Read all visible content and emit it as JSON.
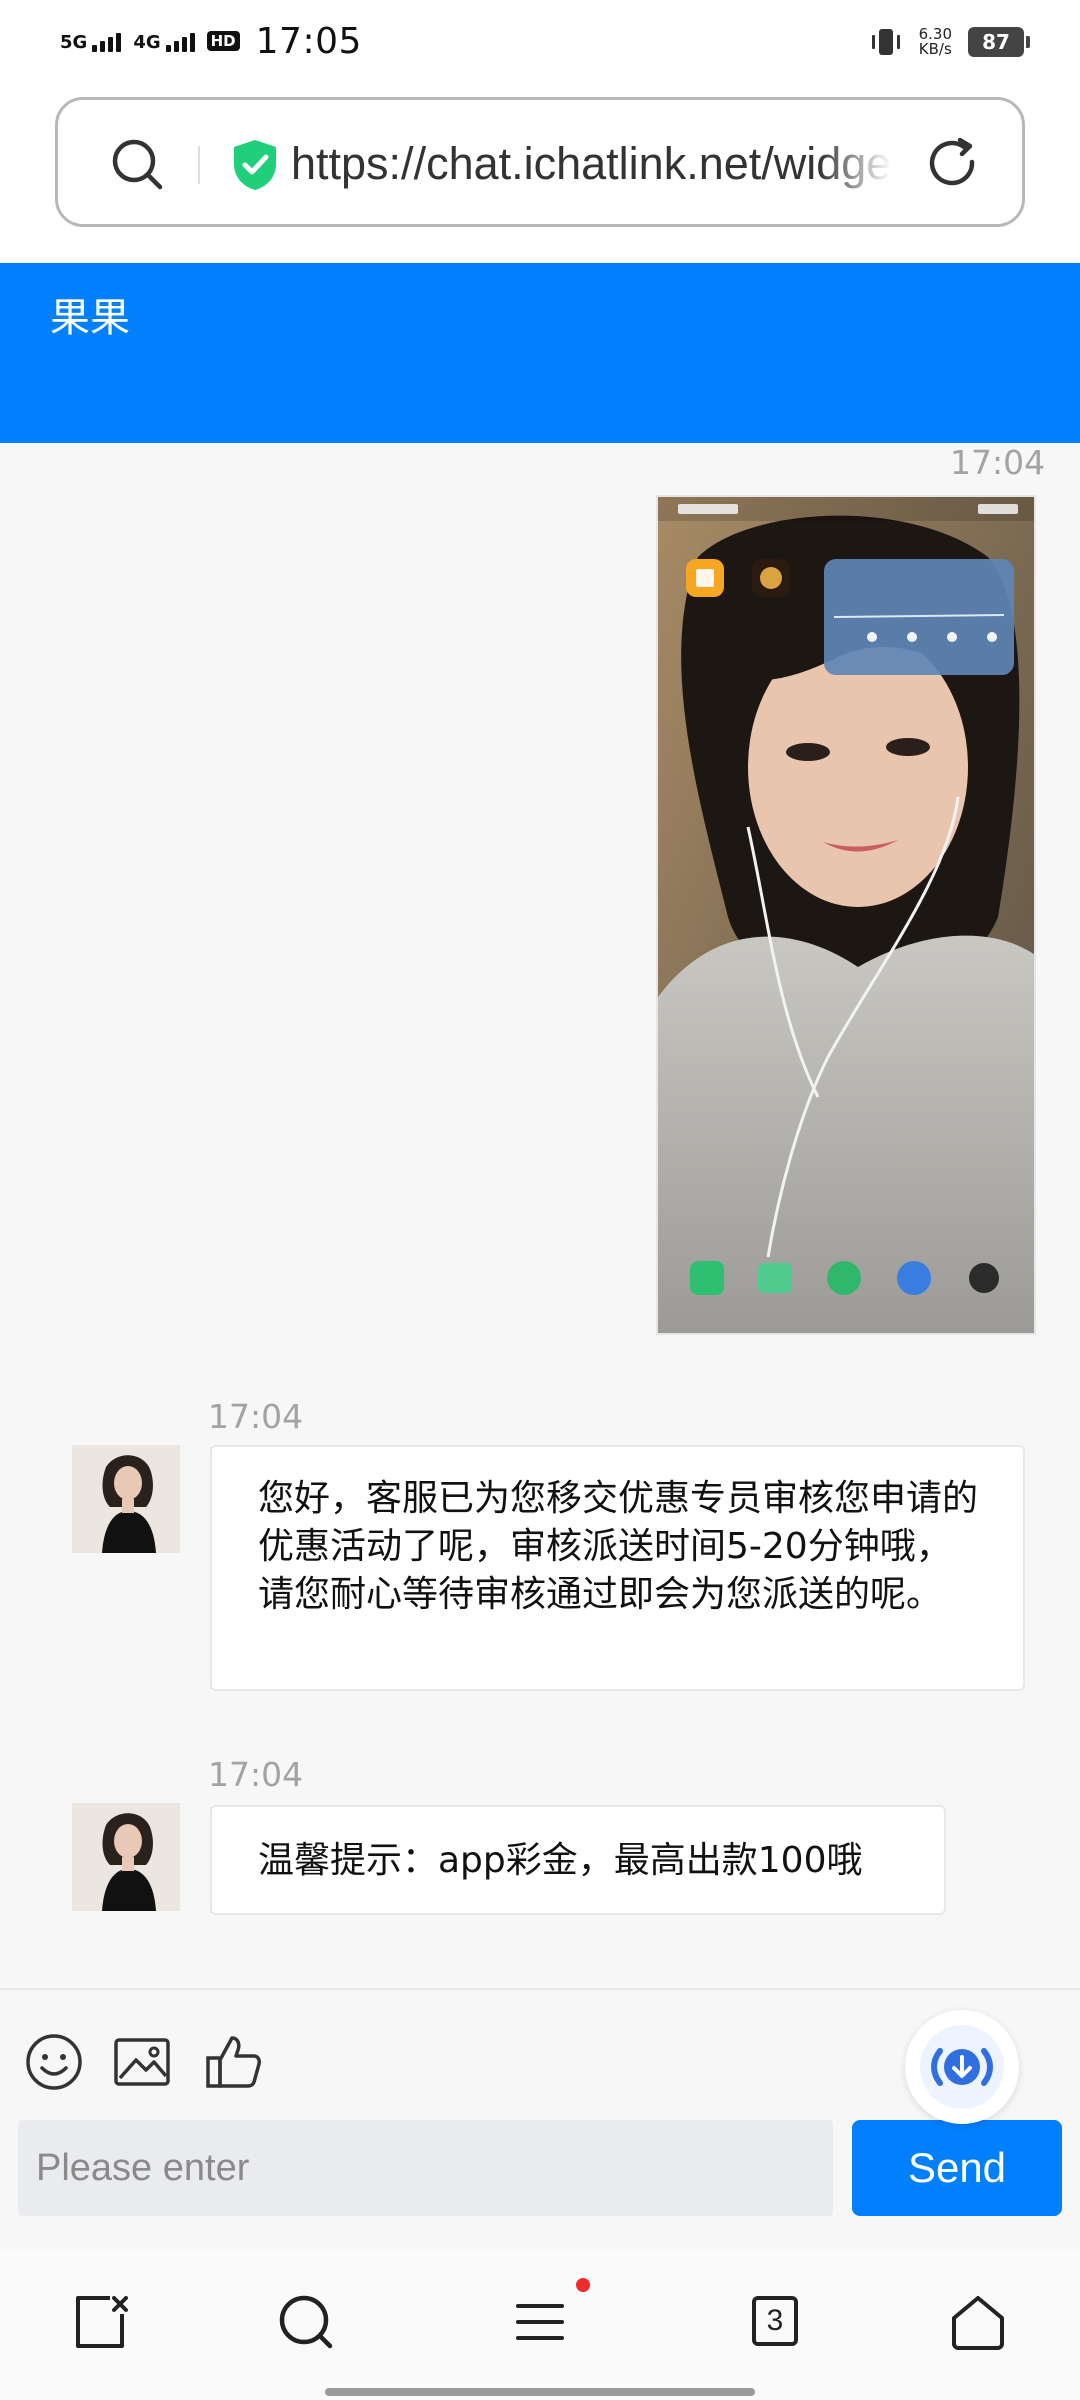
{
  "status_bar": {
    "net1": "5G",
    "net2": "4G",
    "hd": "HD",
    "time": "17:05",
    "speed_value": "6.30",
    "speed_unit": "KB/s",
    "battery": "87"
  },
  "browser": {
    "url": "https://chat.ichatlink.net/widget"
  },
  "chat": {
    "title": "果果",
    "messages": [
      {
        "time": "17:04",
        "type": "image"
      },
      {
        "time": "17:04",
        "text": "您好，客服已为您移交优惠专员审核您申请的优惠活动了呢，审核派送时间5-20分钟哦，请您耐心等待审核通过即会为您派送的呢。"
      },
      {
        "time": "17:04",
        "text": "温馨提示：app彩金，最高出款100哦"
      }
    ]
  },
  "composer": {
    "placeholder": "Please enter",
    "send_label": "Send"
  },
  "bottom_nav": {
    "tabs_count": "3"
  },
  "colors": {
    "accent": "#0080ff",
    "chat_bg": "#f7f7f8",
    "timestamp": "#a3a3a3",
    "notification_dot": "#ef2b2b",
    "shield": "#1fcf7a"
  }
}
